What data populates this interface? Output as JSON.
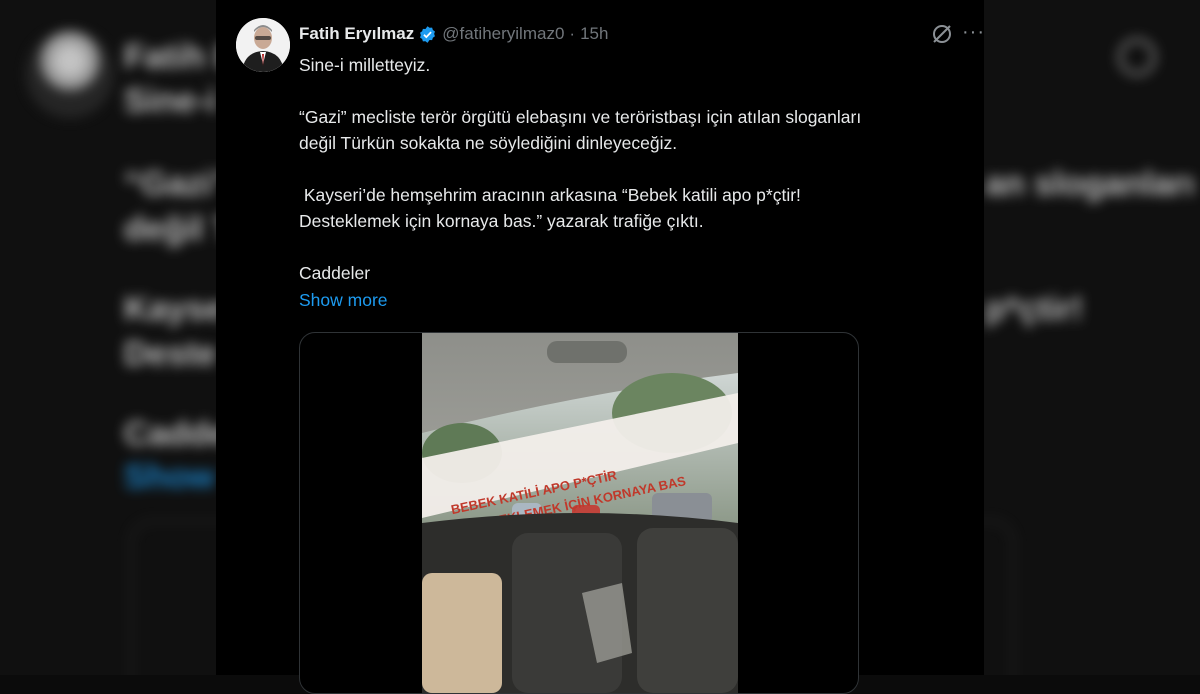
{
  "tweet": {
    "author_name": "Fatih Eryılmaz",
    "handle": "@fatiheryilmaz0",
    "separator": "·",
    "time": "15h",
    "lines": [
      "Sine-i milletteyiz.",
      "",
      "“Gazi” mecliste terör örgütü elebaşını ve teröristbaşı için atılan sloganları",
      "değil Türkün sokakta ne söylediğini dinleyeceğiz.",
      "",
      " Kayseri’de hemşehrim aracının arkasına “Bebek katili apo p*çtir!",
      "Desteklemek için kornaya bas.” yazarak trafiğe çıktı.",
      "",
      "Caddeler"
    ],
    "show_more": "Show more"
  },
  "video_banner_text": [
    "BEBEK KATİLİ APO P*ÇTİR",
    "DESTEKLEMEK İÇİN KORNAYA BAS"
  ],
  "background_blur": {
    "name_fragment": "Fatih E",
    "line1": "Sine-i",
    "line2a": "“Gazi”",
    "line2b": "an sloganları",
    "line3": "değil T",
    "line4a": " Kayse",
    "line4b": "p*çtir!",
    "line5": "Deste",
    "line6": "Cadde",
    "link": "Show"
  },
  "icons": {
    "verified": "verified-badge-icon",
    "grok": "grok-icon",
    "more": "more-options-icon"
  },
  "colors": {
    "background": "#000000",
    "text": "#e7e9ea",
    "muted": "#71767b",
    "link": "#1d9bf0"
  }
}
